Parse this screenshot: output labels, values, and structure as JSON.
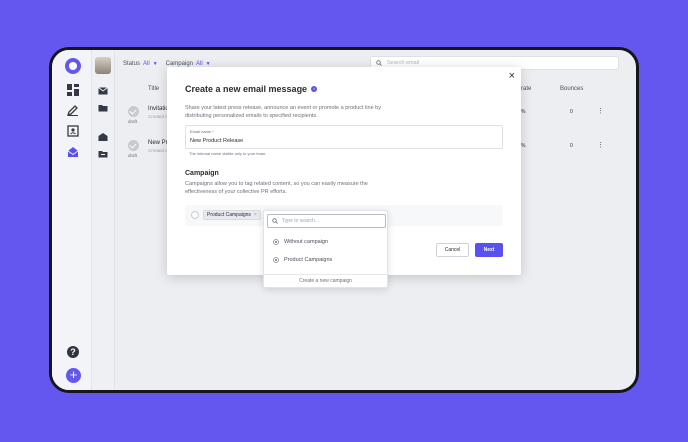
{
  "topbar": {
    "status_label": "Status",
    "status_value": "All",
    "campaign_label": "Campaign",
    "campaign_value": "All",
    "search_placeholder": "Search email"
  },
  "table": {
    "col_title": "Title",
    "col_rate": "rate",
    "col_bounces": "Bounces",
    "rows": [
      {
        "status": "draft",
        "title": "Invitatio",
        "sub": "Created a",
        "rate": "%",
        "bounces": "0"
      },
      {
        "status": "draft",
        "title": "New Pro",
        "sub": "Created a",
        "rate": "%",
        "bounces": "0"
      }
    ]
  },
  "modal": {
    "close": "×",
    "title": "Create a new email message",
    "intro": "Share your latest press release, announce an event or promote a product line by distributing personalized emails to specified recipients.",
    "name_label": "Email name *",
    "name_value": "New Product Release",
    "name_hint": "The internal name visible only to your team.",
    "campaign_heading": "Campaign",
    "campaign_desc": "Campaigns allow you to tag related content, so you can easily measure the effectiveness of your collective PR efforts.",
    "selected_tag": "Product Campaigns",
    "cancel_label": "Cancel",
    "next_label": "Next"
  },
  "dropdown": {
    "search_placeholder": "Type to search...",
    "options": [
      "Without campaign",
      "Product Campaigns"
    ],
    "footer": "Create a new campaign"
  },
  "rail": {
    "help": "?",
    "add": "+"
  },
  "colors": {
    "brand": "#6457f0",
    "accent": "#5a4ff0"
  },
  "icons": [
    "logo-icon",
    "dashboard-icon",
    "pen-icon",
    "contacts-icon",
    "email-icon",
    "help-icon",
    "add-icon",
    "search-icon",
    "info-icon",
    "more-icon"
  ]
}
